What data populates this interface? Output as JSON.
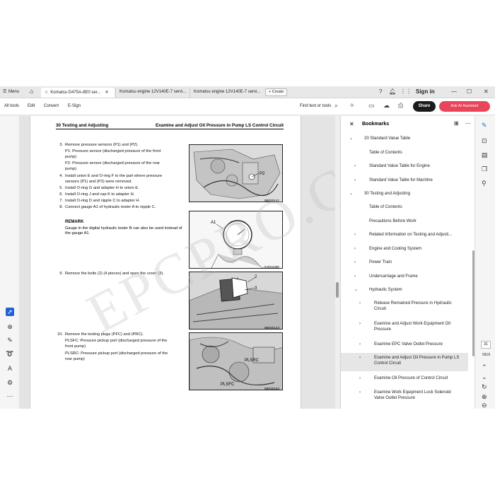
{
  "tabstrip": {
    "menu_label": "Menu",
    "tabs": [
      {
        "label": "Komatsu D475A-8E0 ser...",
        "active": true
      },
      {
        "label": "Komatsu engine 12V140E-7 servi...",
        "active": false
      },
      {
        "label": "Komatsu engine 12V140E-7 servi...",
        "active": false
      }
    ],
    "new_tab_label": "+ Create",
    "sign_in": "Sign in"
  },
  "toolbar": {
    "items": [
      "All tools",
      "Edit",
      "Convert",
      "E-Sign"
    ],
    "find_label": "Find text or tools",
    "share_label": "Share",
    "ai_label": "Ask AI Assistant"
  },
  "page": {
    "header_left": "30 Testing and Adjusting",
    "header_right": "Examine and Adjust Oil Pressure in Pump LS Control Circuit",
    "steps": [
      {
        "n": "3.",
        "text": "Remove pressure sensors (P1) and (P2)."
      },
      {
        "n": "",
        "text": "P1: Pressure sensor (discharged pressure of the front"
      },
      {
        "n": "",
        "text": "      pump)"
      },
      {
        "n": "",
        "text": "P2: Pressure sensor (discharged pressure of the rear"
      },
      {
        "n": "",
        "text": "      pump)"
      },
      {
        "n": "4.",
        "text": "Install union E and O-ring F to the part where pressure"
      },
      {
        "n": "",
        "text": "sensors (P1) and (P2) were removed."
      },
      {
        "n": "5.",
        "text": "Install O-ring G and adapter H to union E."
      },
      {
        "n": "6.",
        "text": "Install O-ring J and cap K to adapter H."
      },
      {
        "n": "7.",
        "text": "Install O-ring D and nipple C to adapter H."
      },
      {
        "n": "8.",
        "text": "Connect gauge A1 of hydraulic tester A to nipple C."
      }
    ],
    "remark_title": "REMARK",
    "remark_text": "Gauge in the digital hydraulic tester B can also be used instead of the gauge A1.",
    "step9": {
      "n": "9.",
      "text": "Remove the bolts (2) (4 pieces) and open the cover (3)."
    },
    "step10": [
      {
        "n": "10.",
        "text": "Remove the testing plugs (PFC) and (PRC)."
      },
      {
        "n": "",
        "text": "PLSFC: Pressure pickup port (discharged pressure of the"
      },
      {
        "n": "",
        "text": "          front pump)"
      },
      {
        "n": "",
        "text": "PLSRC: Pressure pickup port (discharged pressure of the"
      },
      {
        "n": "",
        "text": "          rear pump)"
      }
    ],
    "fig_labels": {
      "f1_code": "9B0S5141",
      "f2_a1": "A1",
      "f2_code": "9JG04499",
      "f3_2": "2",
      "f3_3": "3",
      "f3_code": "9B0S5143",
      "f4_plsrc": "PLSRC",
      "f4_plsfc": "PLSFC",
      "f4_code": "9B0S5153"
    },
    "watermark": "EPCPRO.CO"
  },
  "bookmarks": {
    "title": "Bookmarks",
    "items": [
      {
        "label": "20 Standard Value Table",
        "level": 0,
        "chev": "down"
      },
      {
        "label": "Table of Contents",
        "level": 1,
        "chev": ""
      },
      {
        "label": "Standard Value Table for Engine",
        "level": 1,
        "chev": "right"
      },
      {
        "label": "Standard Value Table for Machine",
        "level": 1,
        "chev": "right"
      },
      {
        "label": "30 Testing and Adjusting",
        "level": 0,
        "chev": "down"
      },
      {
        "label": "Table of Contents",
        "level": 1,
        "chev": ""
      },
      {
        "label": "Precautions Before Work",
        "level": 1,
        "chev": ""
      },
      {
        "label": "Related Information on Testing and Adjusti...",
        "level": 1,
        "chev": "right"
      },
      {
        "label": "Engine and Cooling System",
        "level": 1,
        "chev": "right"
      },
      {
        "label": "Power Train",
        "level": 1,
        "chev": "right"
      },
      {
        "label": "Undercarriage and Frame",
        "level": 1,
        "chev": "right"
      },
      {
        "label": "Hydraulic System",
        "level": 1,
        "chev": "down"
      },
      {
        "label": "Release Remained Pressure in Hydraulic Circuit",
        "level": 2,
        "chev": "right"
      },
      {
        "label": "Examine and Adjust Work Equipment Oil Pressure",
        "level": 2,
        "chev": "right"
      },
      {
        "label": "Examine EPC Valve Outlet Pressure",
        "level": 2,
        "chev": "right"
      },
      {
        "label": "Examine and Adjust Oil Pressure in Pump LS Control Circuit",
        "level": 2,
        "chev": "right",
        "selected": true
      },
      {
        "label": "Examine Oil Pressure of Control Circuit",
        "level": 2,
        "chev": "right"
      },
      {
        "label": "Examine Work Equipment Lock Solenoid Valve Outlet Pressure",
        "level": 2,
        "chev": "right"
      }
    ]
  },
  "right_rail": {
    "page_number": "31",
    "page_total": "5818"
  }
}
